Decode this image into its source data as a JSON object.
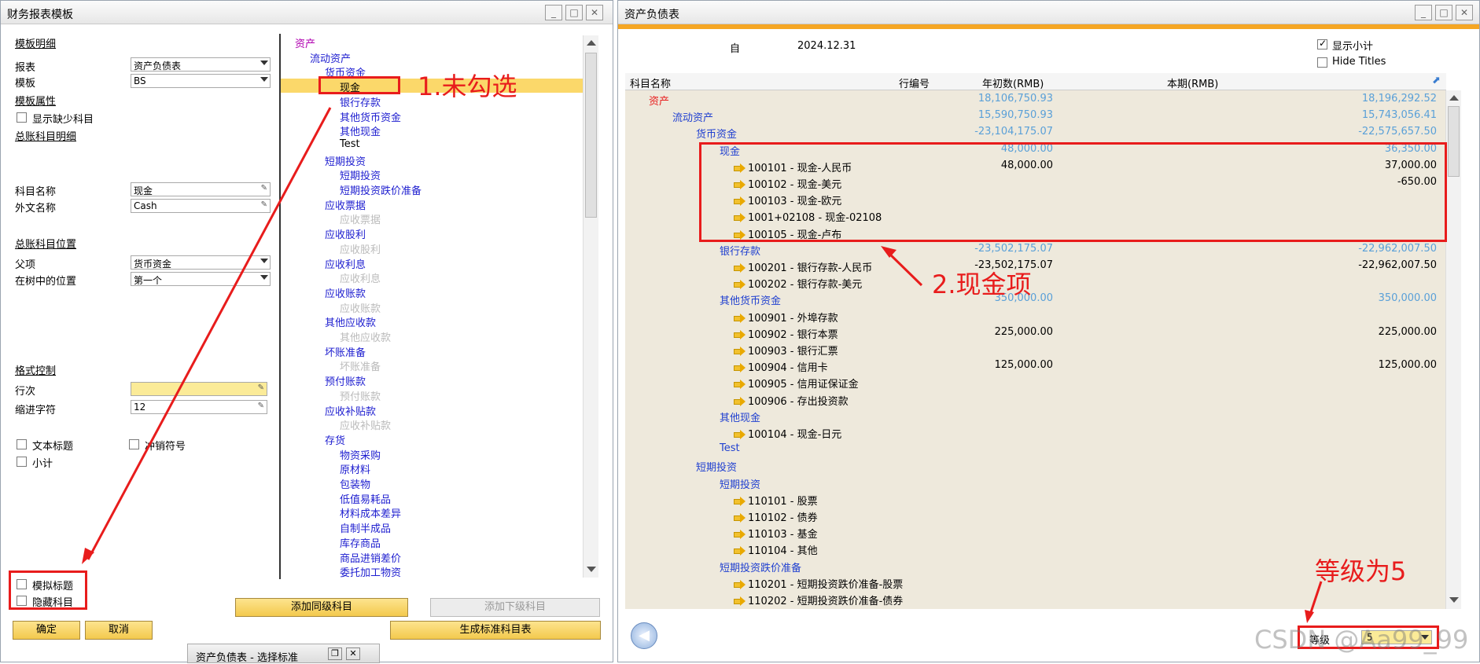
{
  "left_window": {
    "title": "财务报表模板",
    "sections": {
      "template_detail": "模板明细",
      "template_props": "模板属性",
      "gl_detail": "总账科目明细",
      "gl_position": "总账科目位置",
      "format_control": "格式控制"
    },
    "fields": {
      "report_label": "报表",
      "report_value": "资产负债表",
      "template_label": "模板",
      "template_value": "BS",
      "show_missing": "显示缺少科目",
      "account_name_label": "科目名称",
      "account_name_value": "现金",
      "foreign_name_label": "外文名称",
      "foreign_name_value": "Cash",
      "parent_label": "父项",
      "parent_value": "货币资金",
      "tree_pos_label": "在树中的位置",
      "tree_pos_value": "第一个",
      "row_label": "行次",
      "row_value": "",
      "indent_label": "缩进字符",
      "indent_value": "12"
    },
    "checkboxes": {
      "text_title": "文本标题",
      "cancel_sign": "冲销符号",
      "subtotal": "小计",
      "mock_title": "模拟标题",
      "hidden_account": "隐藏科目"
    },
    "buttons": {
      "ok": "确定",
      "cancel": "取消",
      "add_same": "添加同级科目",
      "add_child": "添加下级科目",
      "gen_std": "生成标准科目表"
    },
    "tree": [
      {
        "t": "资产",
        "l": 0,
        "c": "#b000b0"
      },
      {
        "t": "流动资产",
        "l": 1
      },
      {
        "t": "货币资金",
        "l": 2
      },
      {
        "t": "现金",
        "l": 3,
        "c": "#000",
        "sel": true
      },
      {
        "t": "银行存款",
        "l": 3
      },
      {
        "t": "其他货币资金",
        "l": 3
      },
      {
        "t": "其他现金",
        "l": 3
      },
      {
        "t": "Test",
        "l": 3,
        "c": "#000"
      },
      {
        "t": "短期投资",
        "l": 2
      },
      {
        "t": "短期投资",
        "l": 3
      },
      {
        "t": "短期投资跌价准备",
        "l": 3
      },
      {
        "t": "应收票据",
        "l": 2
      },
      {
        "t": "应收票据",
        "l": 3,
        "c": "#bbb"
      },
      {
        "t": "应收股利",
        "l": 2
      },
      {
        "t": "应收股利",
        "l": 3,
        "c": "#bbb"
      },
      {
        "t": "应收利息",
        "l": 2
      },
      {
        "t": "应收利息",
        "l": 3,
        "c": "#bbb"
      },
      {
        "t": "应收账款",
        "l": 2
      },
      {
        "t": "应收账款",
        "l": 3,
        "c": "#bbb"
      },
      {
        "t": "其他应收款",
        "l": 2
      },
      {
        "t": "其他应收款",
        "l": 3,
        "c": "#bbb"
      },
      {
        "t": "坏账准备",
        "l": 2
      },
      {
        "t": "坏账准备",
        "l": 3,
        "c": "#bbb"
      },
      {
        "t": "预付账款",
        "l": 2
      },
      {
        "t": "预付账款",
        "l": 3,
        "c": "#bbb"
      },
      {
        "t": "应收补贴款",
        "l": 2
      },
      {
        "t": "应收补贴款",
        "l": 3,
        "c": "#bbb"
      },
      {
        "t": "存货",
        "l": 2
      },
      {
        "t": "物资采购",
        "l": 3
      },
      {
        "t": "原材料",
        "l": 3
      },
      {
        "t": "包装物",
        "l": 3
      },
      {
        "t": "低值易耗品",
        "l": 3
      },
      {
        "t": "材料成本差异",
        "l": 3
      },
      {
        "t": "自制半成品",
        "l": 3
      },
      {
        "t": "库存商品",
        "l": 3
      },
      {
        "t": "商品进销差价",
        "l": 3
      },
      {
        "t": "委托加工物资",
        "l": 3
      }
    ],
    "bottom_tab": "资产负债表 - 选择标准"
  },
  "right_window": {
    "title": "资产负债表",
    "from_label": "自",
    "date": "2024.12.31",
    "show_subtotal": "显示小计",
    "hide_titles": "Hide Titles",
    "columns": [
      "科目名称",
      "行编号",
      "年初数(RMB)",
      "本期(RMB)"
    ],
    "rows": [
      {
        "name": "资产",
        "lv": 0,
        "c": "#e81c1c",
        "a": "18,106,750.93",
        "b": "18,196,292.52",
        "tc": "#5aa0d8"
      },
      {
        "name": "流动资产",
        "lv": 1,
        "c": "#2040d0",
        "a": "15,590,750.93",
        "b": "15,743,056.41",
        "tc": "#5aa0d8"
      },
      {
        "name": "货币资金",
        "lv": 2,
        "c": "#2040d0",
        "a": "-23,104,175.07",
        "b": "-22,575,657.50",
        "tc": "#5aa0d8"
      },
      {
        "name": "现金",
        "lv": 3,
        "c": "#2040d0",
        "a": "48,000.00",
        "b": "36,350.00",
        "tc": "#5aa0d8"
      },
      {
        "name": "100101 - 现金-人民币",
        "lv": 4,
        "acct": true,
        "a": "48,000.00",
        "b": "37,000.00"
      },
      {
        "name": "100102 - 现金-美元",
        "lv": 4,
        "acct": true,
        "a": "",
        "b": "-650.00"
      },
      {
        "name": "100103 - 现金-欧元",
        "lv": 4,
        "acct": true,
        "a": "",
        "b": ""
      },
      {
        "name": "1001+02108 - 现金-02108",
        "lv": 4,
        "acct": true,
        "a": "",
        "b": ""
      },
      {
        "name": "100105 - 现金-卢布",
        "lv": 4,
        "acct": true,
        "a": "",
        "b": ""
      },
      {
        "name": "银行存款",
        "lv": 3,
        "c": "#2040d0",
        "a": "-23,502,175.07",
        "b": "-22,962,007.50",
        "tc": "#5aa0d8"
      },
      {
        "name": "100201 - 银行存款-人民币",
        "lv": 4,
        "acct": true,
        "a": "-23,502,175.07",
        "b": "-22,962,007.50"
      },
      {
        "name": "100202 - 银行存款-美元",
        "lv": 4,
        "acct": true,
        "a": "",
        "b": ""
      },
      {
        "name": "其他货币资金",
        "lv": 3,
        "c": "#2040d0",
        "a": "350,000.00",
        "b": "350,000.00",
        "tc": "#5aa0d8"
      },
      {
        "name": "100901 - 外埠存款",
        "lv": 4,
        "acct": true,
        "a": "",
        "b": ""
      },
      {
        "name": "100902 - 银行本票",
        "lv": 4,
        "acct": true,
        "a": "225,000.00",
        "b": "225,000.00"
      },
      {
        "name": "100903 - 银行汇票",
        "lv": 4,
        "acct": true,
        "a": "",
        "b": ""
      },
      {
        "name": "100904 - 信用卡",
        "lv": 4,
        "acct": true,
        "a": "125,000.00",
        "b": "125,000.00"
      },
      {
        "name": "100905 - 信用证保证金",
        "lv": 4,
        "acct": true,
        "a": "",
        "b": ""
      },
      {
        "name": "100906 - 存出投资款",
        "lv": 4,
        "acct": true,
        "a": "",
        "b": ""
      },
      {
        "name": "其他现金",
        "lv": 3,
        "c": "#2040d0",
        "a": "",
        "b": ""
      },
      {
        "name": "100104 - 现金-日元",
        "lv": 4,
        "acct": true,
        "a": "",
        "b": ""
      },
      {
        "name": "Test",
        "lv": 3,
        "c": "#2040d0",
        "a": "",
        "b": ""
      },
      {
        "name": "短期投资",
        "lv": 2,
        "c": "#2040d0",
        "a": "",
        "b": ""
      },
      {
        "name": "短期投资",
        "lv": 3,
        "c": "#2040d0",
        "a": "",
        "b": ""
      },
      {
        "name": "110101 - 股票",
        "lv": 4,
        "acct": true,
        "a": "",
        "b": ""
      },
      {
        "name": "110102 - 债券",
        "lv": 4,
        "acct": true,
        "a": "",
        "b": ""
      },
      {
        "name": "110103 - 基金",
        "lv": 4,
        "acct": true,
        "a": "",
        "b": ""
      },
      {
        "name": "110104 - 其他",
        "lv": 4,
        "acct": true,
        "a": "",
        "b": ""
      },
      {
        "name": "短期投资跌价准备",
        "lv": 3,
        "c": "#2040d0",
        "a": "",
        "b": ""
      },
      {
        "name": "110201 - 短期投资跌价准备-股票",
        "lv": 4,
        "acct": true,
        "a": "",
        "b": ""
      },
      {
        "name": "110202 - 短期投资跌价准备-债券",
        "lv": 4,
        "acct": true,
        "a": "",
        "b": ""
      }
    ],
    "level_label": "等级",
    "level_value": "5"
  },
  "annotations": {
    "a1": "1.未勾选",
    "a2": "2.现金项",
    "a3": "等级为5"
  },
  "watermark": "CSDN @Aa99_99",
  "colors": {
    "accent": "#f5a623",
    "red": "#e81c1c",
    "link": "#2040d0"
  }
}
